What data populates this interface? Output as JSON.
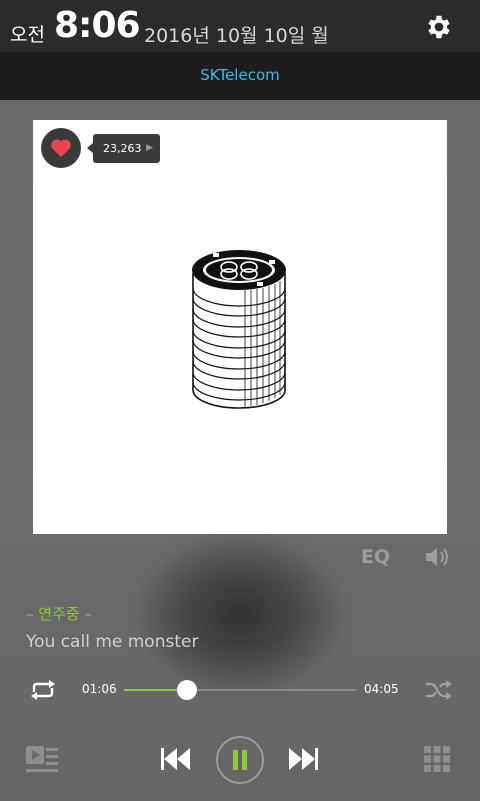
{
  "status_bar": {
    "ampm": "오전",
    "time": "8:06",
    "date": "2016년 10월 10일 월"
  },
  "carrier": "SKTelecom",
  "player": {
    "like_count": "23,263",
    "eq_label": "EQ",
    "status": "– 연주중 –",
    "lyric": "You call me monster",
    "current_time": "01:06",
    "total_time": "04:05",
    "progress_fraction": 0.27,
    "accent_color": "#8dc63f",
    "heart_color": "#e8454c"
  },
  "icons": [
    "gear-icon",
    "heart-icon",
    "volume-icon",
    "repeat-icon",
    "shuffle-icon",
    "playlist-icon",
    "previous-icon",
    "pause-icon",
    "next-icon",
    "grid-menu-icon"
  ]
}
